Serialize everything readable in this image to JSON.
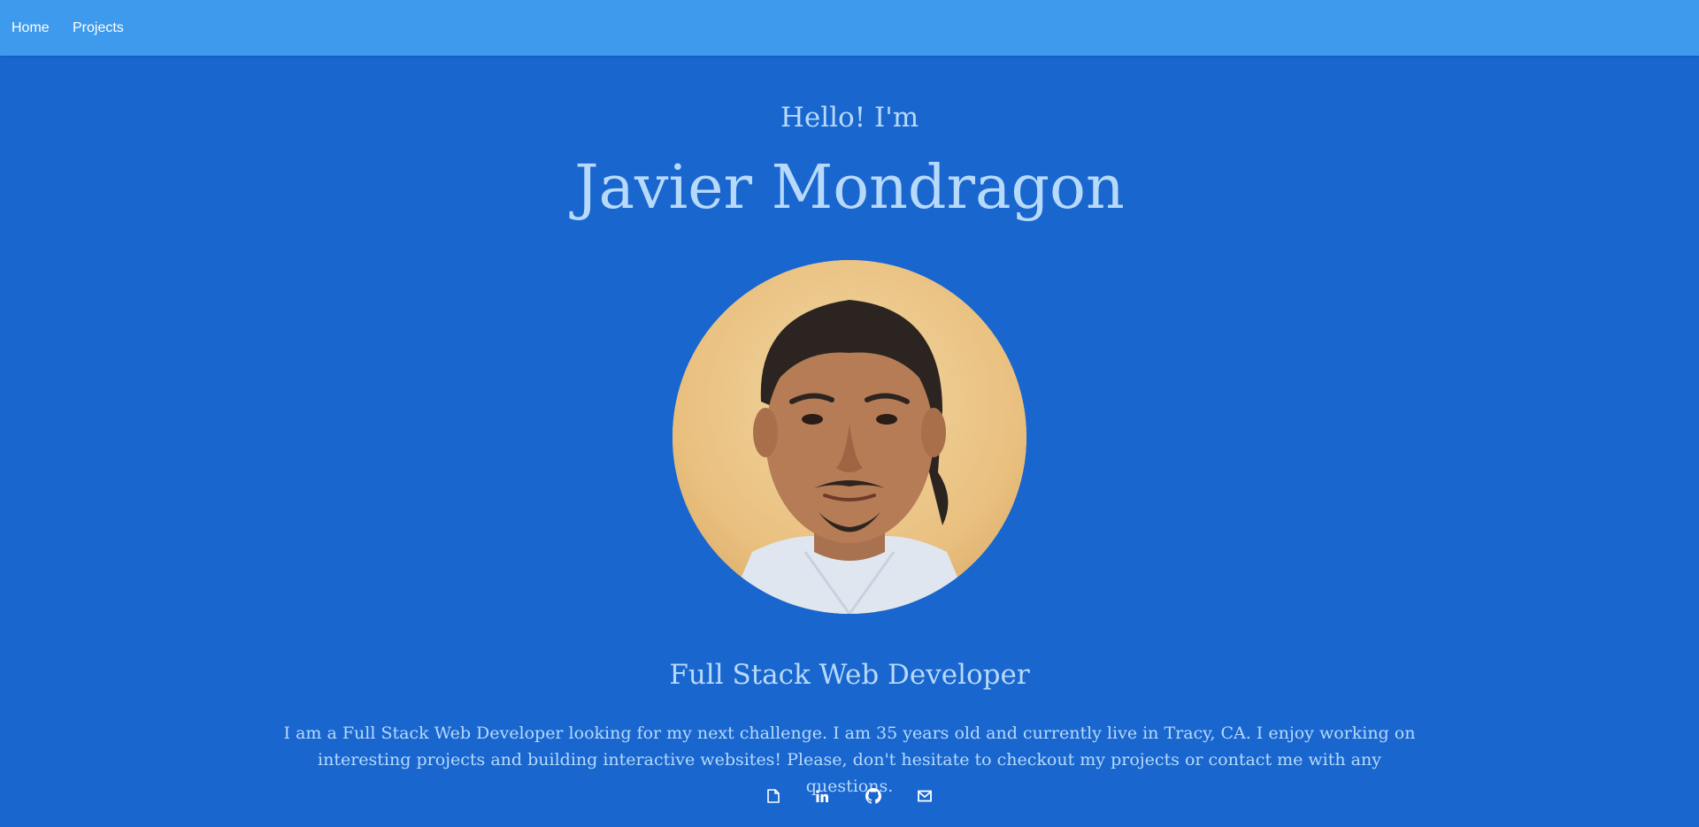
{
  "nav": {
    "items": [
      {
        "label": "Home"
      },
      {
        "label": "Projects"
      }
    ]
  },
  "hero": {
    "greeting": "Hello! I'm",
    "name": "Javier Mondragon",
    "title": "Full Stack Web Developer",
    "bio": "I am a Full Stack Web Developer looking for my next challenge. I am 35 years old and currently live in Tracy, CA. I enjoy working on interesting projects and building interactive websites! Please, don't hesitate to checkout my projects or contact me with any questions."
  },
  "social_icons": [
    "file-icon",
    "linkedin-icon",
    "github-icon",
    "email-icon"
  ],
  "colors": {
    "navbar": "#3d9aec",
    "background": "#1966cf",
    "text": "#b7dafa",
    "nav_text": "#ffffff"
  }
}
